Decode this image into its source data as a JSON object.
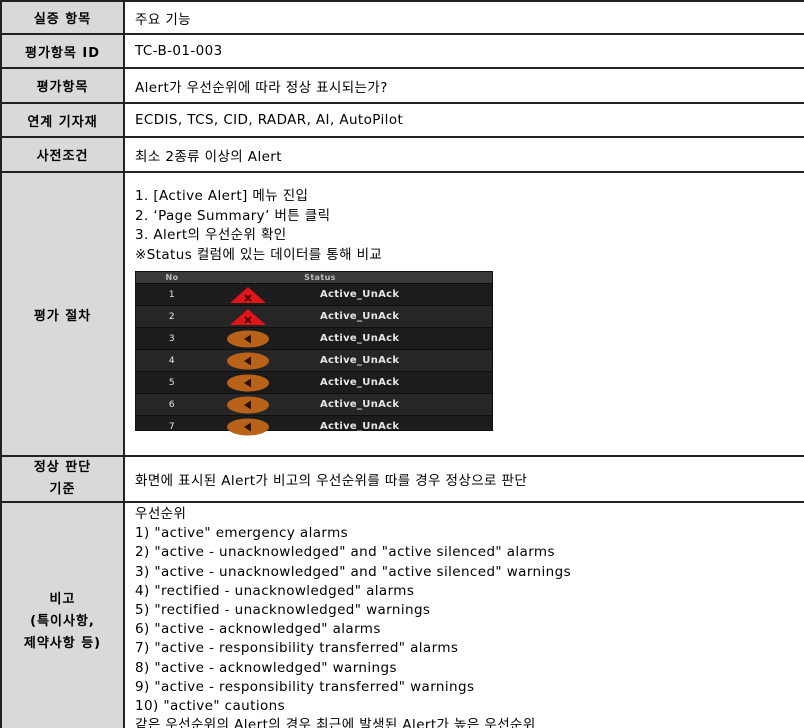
{
  "rows": {
    "item": {
      "label": "실증 항목",
      "value": "주요 기능"
    },
    "eval_id": {
      "label": "평가항목 ID",
      "value": "TC-B-01-003"
    },
    "eval_item": {
      "label": "평가항목",
      "value": "Alert가 우선순위에 따라 정상 표시되는가?"
    },
    "equipment": {
      "label": "연계 기자재",
      "value": "ECDIS, TCS, CID, RADAR, AI, AutoPilot"
    },
    "precondition": {
      "label": "사전조건",
      "value": "최소 2종류 이상의 Alert"
    },
    "procedure": {
      "label": "평가 절차",
      "steps": [
        "1. [Active Alert] 메뉴 진입",
        "2. ‘Page Summary’ 버튼 클릭",
        "3. Alert의 우선순위 확인",
        "※Status 컬럼에 있는 데이터를 통해 비교"
      ],
      "status_table": {
        "headers": [
          "No",
          "Status"
        ],
        "rows": [
          {
            "no": "1",
            "icon": "emergency-alarm-triangle-icon",
            "status": "Active_UnAck"
          },
          {
            "no": "2",
            "icon": "emergency-alarm-triangle-icon",
            "status": "Active_UnAck"
          },
          {
            "no": "3",
            "icon": "warning-speaker-circle-icon",
            "status": "Active_UnAck"
          },
          {
            "no": "4",
            "icon": "warning-speaker-circle-icon",
            "status": "Active_UnAck"
          },
          {
            "no": "5",
            "icon": "warning-speaker-circle-icon",
            "status": "Active_UnAck"
          },
          {
            "no": "6",
            "icon": "warning-speaker-circle-icon",
            "status": "Active_UnAck"
          },
          {
            "no": "7",
            "icon": "warning-speaker-circle-icon",
            "status": "Active_UnAck"
          }
        ]
      }
    },
    "criteria": {
      "label_lines": [
        "정상 판단",
        "기준"
      ],
      "value": "화면에 표시된 Alert가 비고의 우선순위를 따를 경우 정상으로 판단"
    },
    "notes": {
      "label_lines": [
        "비고",
        "(특이사항,",
        "제약사항 등)"
      ],
      "lines": [
        "우선순위",
        "1) \"active\" emergency alarms",
        "2) \"active - unacknowledged\" and \"active silenced\" alarms",
        "3) \"active - unacknowledged\" and \"active silenced\" warnings",
        "4) \"rectified - unacknowledged\" alarms",
        "5) \"rectified - unacknowledged\" warnings",
        "6) \"active - acknowledged\" alarms",
        "7) \"active - responsibility transferred\" alarms",
        "8) \"active - acknowledged\" warnings",
        "9) \"active - responsibility transferred\" warnings",
        "10) \"active\" cautions",
        "같은 우선순위의 Alert의 경우 최근에 발생된 Alert가 높은 우선순위"
      ]
    }
  },
  "colors": {
    "label_bg": "#d9d9d9",
    "alarm_red": "#e0141b",
    "warning_orange": "#b8621a",
    "panel_dark": "#1c1c1c"
  }
}
